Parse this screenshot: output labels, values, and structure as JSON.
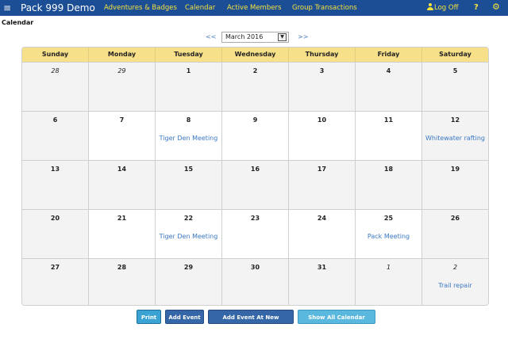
{
  "header": {
    "menu_icon": "hamburger-icon",
    "brand": "Pack 999 Demo",
    "nav": [
      "Adventures & Badges",
      "Calendar",
      "Active Members",
      "Group Transactions"
    ],
    "logoff": "Log Off",
    "help": "?",
    "settings_icon": "gear-icon"
  },
  "page": {
    "title": "Calendar"
  },
  "month_nav": {
    "prev": "<<",
    "selected": "March 2016",
    "next": ">>"
  },
  "calendar": {
    "weekdays": [
      "Sunday",
      "Monday",
      "Tuesday",
      "Wednesday",
      "Thursday",
      "Friday",
      "Saturday"
    ],
    "weeks": [
      [
        {
          "day": "28",
          "other": true
        },
        {
          "day": "29",
          "other": true
        },
        {
          "day": "1"
        },
        {
          "day": "2"
        },
        {
          "day": "3"
        },
        {
          "day": "4"
        },
        {
          "day": "5"
        }
      ],
      [
        {
          "day": "6"
        },
        {
          "day": "7"
        },
        {
          "day": "8",
          "event": "Tiger Den Meeting"
        },
        {
          "day": "9"
        },
        {
          "day": "10"
        },
        {
          "day": "11"
        },
        {
          "day": "12",
          "event": "Whitewater rafting"
        }
      ],
      [
        {
          "day": "13"
        },
        {
          "day": "14"
        },
        {
          "day": "15"
        },
        {
          "day": "16"
        },
        {
          "day": "17"
        },
        {
          "day": "18"
        },
        {
          "day": "19"
        }
      ],
      [
        {
          "day": "20"
        },
        {
          "day": "21"
        },
        {
          "day": "22",
          "event": "Tiger Den Meeting"
        },
        {
          "day": "23"
        },
        {
          "day": "24"
        },
        {
          "day": "25",
          "event": "Pack Meeting"
        },
        {
          "day": "26"
        }
      ],
      [
        {
          "day": "27"
        },
        {
          "day": "28"
        },
        {
          "day": "29"
        },
        {
          "day": "30"
        },
        {
          "day": "31"
        },
        {
          "day": "1",
          "other": true
        },
        {
          "day": "2",
          "other": true,
          "event": "Trail repair"
        }
      ]
    ]
  },
  "buttons": {
    "print": "Print",
    "add_event": "Add Event",
    "add_event_location": "Add Event At New Location",
    "show_all": "Show All Calendar Items"
  }
}
